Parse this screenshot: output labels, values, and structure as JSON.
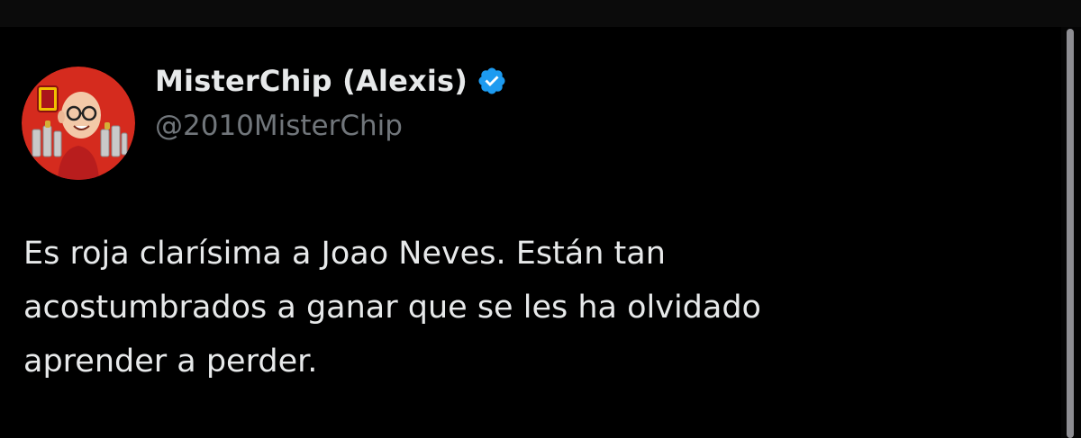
{
  "tweet": {
    "author": {
      "display_name": "MisterChip (Alexis)",
      "handle": "@2010MisterChip",
      "verified": true,
      "avatar_icon": "avatar-caricature-icon",
      "verified_icon": "verified-badge-icon"
    },
    "text_lines": [
      "Es roja clarísima a Joao Neves. Están tan",
      "acostumbrados a ganar que se les ha olvidado",
      "aprender a perder."
    ]
  },
  "colors": {
    "background": "#000000",
    "primary_text": "#e7e9ea",
    "secondary_text": "#71767b",
    "verified_blue": "#1d9bf0",
    "avatar_red": "#d52b1e"
  }
}
